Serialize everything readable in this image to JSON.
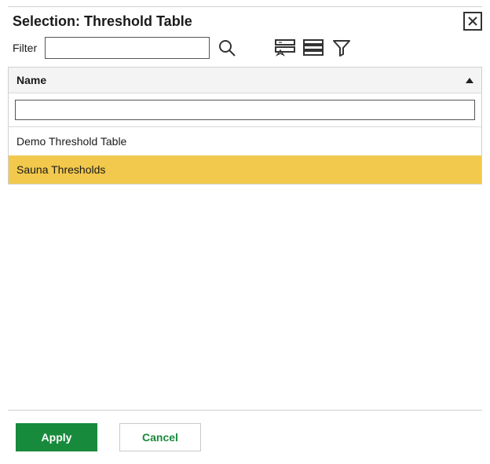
{
  "header": {
    "title": "Selection: Threshold Table"
  },
  "filter": {
    "label": "Filter",
    "value": "",
    "placeholder": ""
  },
  "toolbar": {
    "search": "search-icon",
    "clear_selection": "clear-selection-icon",
    "select_all": "select-all-icon",
    "filter_icon": "funnel-icon"
  },
  "table": {
    "column_header": "Name",
    "sort_direction": "asc",
    "column_filter_value": "",
    "rows": [
      {
        "name": "Demo Threshold Table",
        "selected": false
      },
      {
        "name": "Sauna Thresholds",
        "selected": true
      }
    ]
  },
  "footer": {
    "apply": "Apply",
    "cancel": "Cancel"
  },
  "colors": {
    "primary": "#188a3c",
    "highlight": "#f2c94c"
  }
}
